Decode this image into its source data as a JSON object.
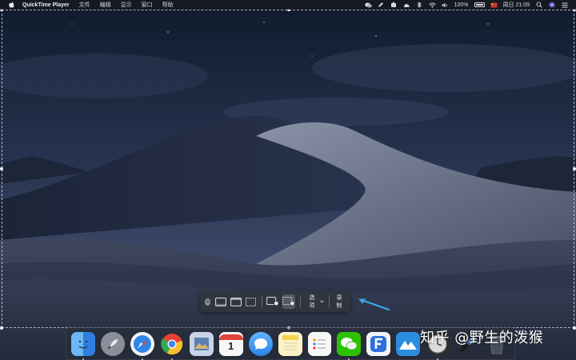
{
  "menubar": {
    "app_name": "QuickTime Player",
    "menus": [
      "文件",
      "编辑",
      "显示",
      "窗口",
      "帮助"
    ],
    "battery_percent": "100%",
    "clock": "周日 21:09"
  },
  "toolbar": {
    "options_label": "选项",
    "record_label": "录制",
    "selected_mode": "record-selected-portion"
  },
  "dock": {
    "items": [
      {
        "name": "Finder",
        "icon": "finder-icon",
        "color": "#3b8fe8"
      },
      {
        "name": "Launchpad",
        "icon": "rocket-icon",
        "color": "#6b7280"
      },
      {
        "name": "Safari",
        "icon": "compass-icon",
        "color": "#2f7fe0"
      },
      {
        "name": "Chrome",
        "icon": "chrome-icon",
        "color": "#e94235"
      },
      {
        "name": "Preview",
        "icon": "photos-icon",
        "color": "#5b7fb3"
      },
      {
        "name": "Calendar",
        "icon": "calendar-icon",
        "color": "#f4f4f4",
        "text": "1"
      },
      {
        "name": "Messages",
        "icon": "speech-bubble-icon",
        "color": "#3c9df0"
      },
      {
        "name": "Notes",
        "icon": "notes-icon",
        "color": "#f7e27a"
      },
      {
        "name": "Reminders",
        "icon": "list-icon",
        "color": "#f2f2f2"
      },
      {
        "name": "WeChat",
        "icon": "wechat-icon",
        "color": "#2dc100"
      },
      {
        "name": "F App",
        "icon": "f-letter-icon",
        "color": "#2c6fdf"
      },
      {
        "name": "Mountain App",
        "icon": "mountain-icon",
        "color": "#2a8de0"
      },
      {
        "name": "Clock",
        "icon": "clock-icon",
        "color": "#3a3a3a"
      },
      {
        "name": "Tool",
        "icon": "brush-icon",
        "color": "#1c1c1c"
      },
      {
        "name": "Trash",
        "icon": "trash-icon",
        "color": "#555b63"
      }
    ]
  },
  "watermark": "知乎 @野生的泼猴"
}
